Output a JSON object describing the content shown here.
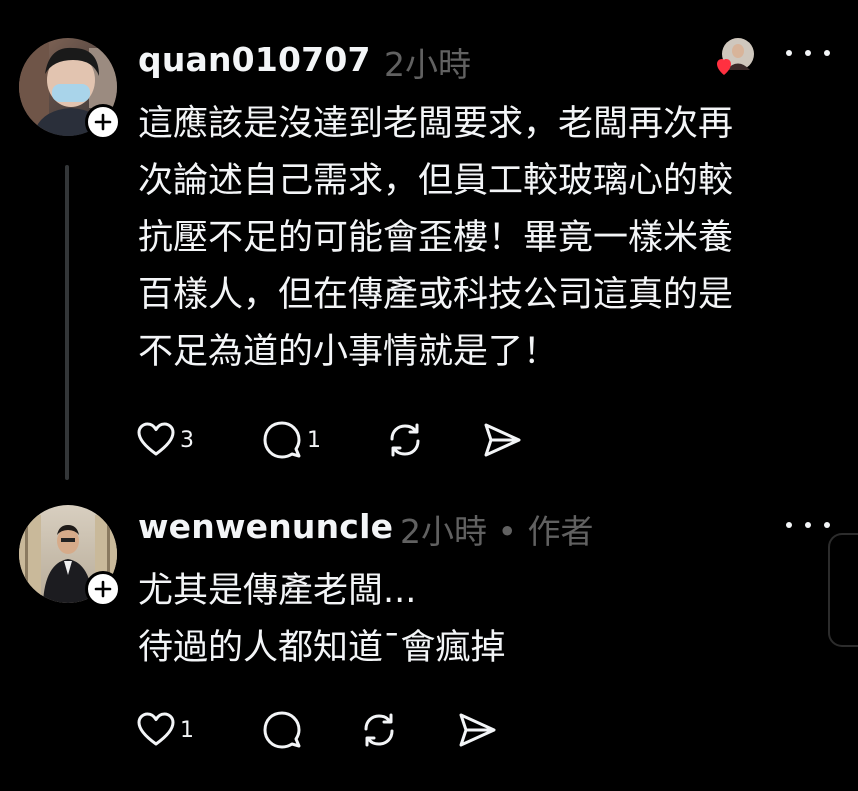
{
  "comments": [
    {
      "username": "quan010707",
      "time": "2小時",
      "author_tag": "",
      "avatar_icon": "avatar-boy-with-mask",
      "lines": [
        "這應該是沒達到老闆要求，老闆再次再",
        "次論述自己需求，但員工較玻璃心的較",
        "抗壓不足的可能會歪樓！畢竟一樣米養",
        "百樣人，但在傳產或科技公司這真的是",
        "不足為道的小事情就是了！"
      ],
      "like_count": "3",
      "reply_count": "1",
      "liked_by_author": true
    },
    {
      "username": "wenwenuncle",
      "time": "2小時",
      "author_tag": "• 作者",
      "avatar_icon": "avatar-man-in-suit",
      "lines": [
        "尤其是傳產老闆...",
        "待過的人都知道ˉ會瘋掉"
      ],
      "like_count": "1",
      "reply_count": "",
      "liked_by_author": false
    }
  ],
  "colors": {
    "background": "#000000",
    "text": "#f3f5f7",
    "muted": "#616161",
    "heart": "#ff3040",
    "thread_line": "#333638"
  },
  "icons": [
    "heart-icon",
    "comment-icon",
    "repost-icon",
    "share-icon",
    "more-icon",
    "plus-icon"
  ]
}
